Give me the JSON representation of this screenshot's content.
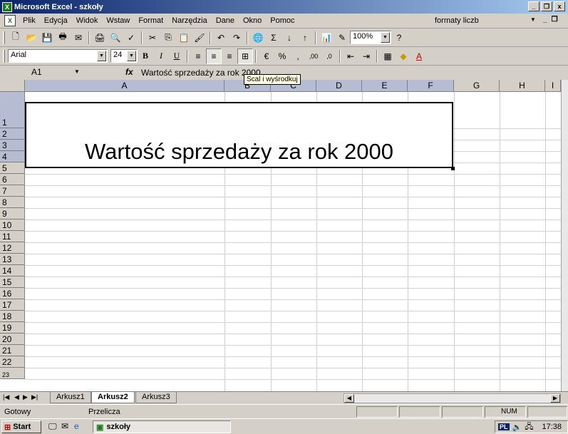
{
  "window": {
    "title": "Microsoft Excel - szkoły",
    "app_icon": "excel-icon"
  },
  "menu": {
    "items": [
      {
        "label": "Plik"
      },
      {
        "label": "Edycja"
      },
      {
        "label": "Widok"
      },
      {
        "label": "Wstaw"
      },
      {
        "label": "Format"
      },
      {
        "label": "Narzędzia"
      },
      {
        "label": "Dane"
      },
      {
        "label": "Okno"
      },
      {
        "label": "Pomoc"
      }
    ],
    "question_box": "formaty liczb"
  },
  "standard_toolbar": {
    "zoom": "100%"
  },
  "formatting_toolbar": {
    "font": "Arial",
    "size": "24",
    "bold": "B",
    "italic": "I",
    "underline": "U",
    "percent": "%",
    "comma": ",",
    "inc_decimal": ",00",
    "dec_decimal": ",0"
  },
  "formula_bar": {
    "name_box": "A1",
    "fx": "fx",
    "content": "Wartość sprzedaży za rok 2000"
  },
  "tooltip": "Scal i wyśrodkuj",
  "columns": [
    "A",
    "B",
    "C",
    "D",
    "E",
    "F",
    "G",
    "H",
    "I"
  ],
  "rows": [
    "1",
    "2",
    "3",
    "4",
    "5",
    "6",
    "7",
    "8",
    "9",
    "10",
    "11",
    "12",
    "13",
    "14",
    "15",
    "16",
    "17",
    "18",
    "19",
    "20",
    "21",
    "22",
    "23"
  ],
  "merged_cell": {
    "text": "Wartość sprzedaży za rok 2000"
  },
  "sheets": [
    {
      "label": "Arkusz1"
    },
    {
      "label": "Arkusz2",
      "active": true
    },
    {
      "label": "Arkusz3"
    }
  ],
  "status": {
    "left": "Gotowy",
    "mode": "Przelicza",
    "num": "NUM"
  },
  "taskbar": {
    "start": "Start",
    "task": "szkoły",
    "lang": "PL",
    "clock": "17:38"
  }
}
